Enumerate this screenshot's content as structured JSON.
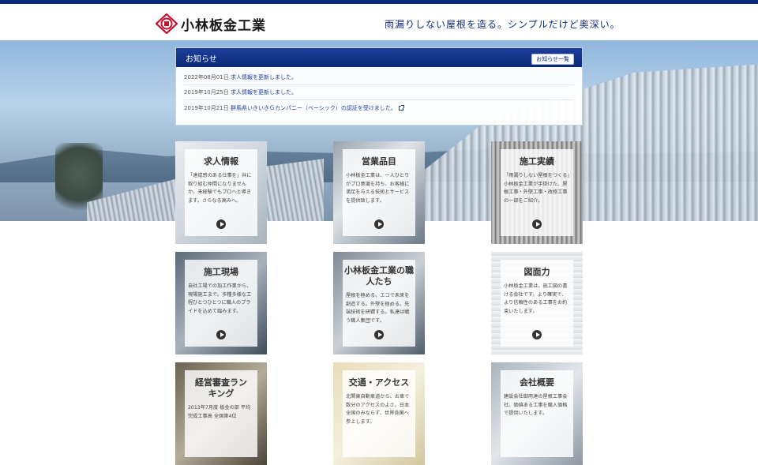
{
  "header": {
    "logo_text": "小林板金工業",
    "tagline": "雨漏りしない屋根を造る。シンプルだけど奥深い。"
  },
  "notice": {
    "title": "お知らせ",
    "more_label": "お知らせ一覧",
    "items": [
      {
        "date": "2022年08月01日",
        "text": "求人情報を更新しました。"
      },
      {
        "date": "2019年10月25日",
        "text": "求人情報を更新しました。"
      },
      {
        "date": "2019年10月21日",
        "text": "群馬県いきいきＧカンパニー（ベーシック）の認証を受けました。"
      }
    ]
  },
  "cards": [
    {
      "title": "求人情報",
      "text": "「達成感のある仕事を」共に取り組む仲間になりませんか。未経験でもプロへと導きます。さらなる高みへ。"
    },
    {
      "title": "営業品目",
      "text": "小林板金工業は、一人ひとりがプロ意識を持ち、お客様に満足を与える技術とサービスを提供致します。"
    },
    {
      "title": "施工実績",
      "text": "「雨漏りしない屋根をつくる」小林板金工業が手掛けた、屋根工事・外壁工事・改修工事の一部をご紹介。"
    },
    {
      "title": "施工現場",
      "text": "自社工場での加工作業から、現場施工まで。多種多様な工程ひとつひとつに職人のプライドを込めて臨みます。"
    },
    {
      "title": "小林板金工業の職人たち",
      "text": "屋根を極める。エコで未来を創造する。外壁を極める。先端技術を研鑽する。私達は戦う職人集団です。"
    },
    {
      "title": "図面力",
      "text": "小林板金工業は、施工図の書ける会社です。より確実で、より信頼性のある工事をお約束いたします。"
    },
    {
      "title": "経営審査ランキング",
      "text": "2013年7月度 板金の部 平均完成工事高 全国第4位"
    },
    {
      "title": "交通・アクセス",
      "text": "北関東自動車道から、お車で数分のアクセスのよさ。日本全国のみならず、世界各国へ参上します。"
    },
    {
      "title": "会社概要",
      "text": "建設会社御用達の屋根工事会社。価値ある工事を職人価格で提供いたします。"
    }
  ],
  "colors": {
    "brand_navy": "#0d2a78",
    "logo_red": "#c8102e"
  },
  "icons": {
    "logo": "kobayashi-seal-icon",
    "external_link": "external-link-icon",
    "play": "play-circle-icon"
  }
}
